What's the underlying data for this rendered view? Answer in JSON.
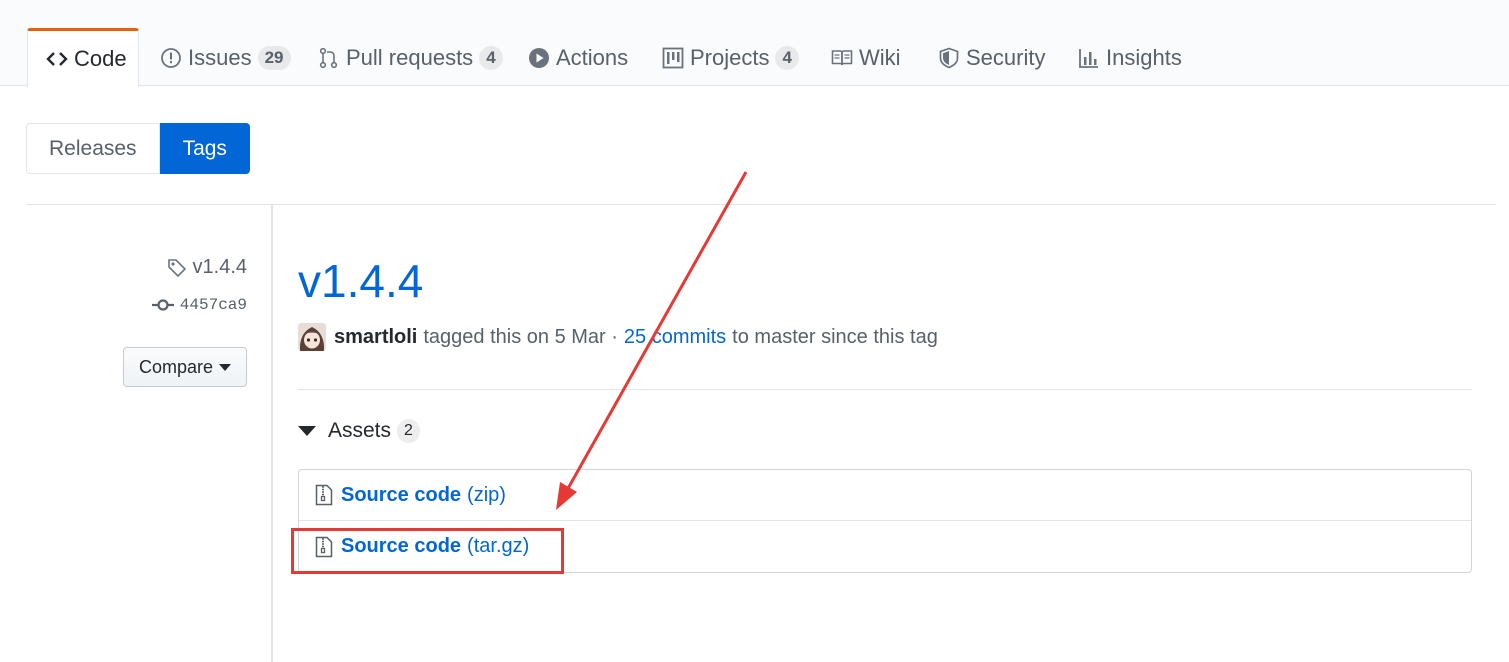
{
  "nav": {
    "tabs": [
      {
        "label": "Code",
        "icon": "code-icon",
        "selected": true
      },
      {
        "label": "Issues",
        "icon": "issue-opened-icon",
        "count": "29"
      },
      {
        "label": "Pull requests",
        "icon": "git-pull-request-icon",
        "count": "4"
      },
      {
        "label": "Actions",
        "icon": "play-icon"
      },
      {
        "label": "Projects",
        "icon": "project-icon",
        "count": "4"
      },
      {
        "label": "Wiki",
        "icon": "book-icon"
      },
      {
        "label": "Security",
        "icon": "shield-icon"
      },
      {
        "label": "Insights",
        "icon": "graph-icon"
      }
    ],
    "accent": "#e36209"
  },
  "subnav": {
    "releases_label": "Releases",
    "tags_label": "Tags"
  },
  "meta": {
    "tag": "v1.4.4",
    "commit": "4457ca9",
    "compare_label": "Compare"
  },
  "release": {
    "title": "v1.4.4",
    "author": "smartloli",
    "tagged_text": "tagged this on 5 Mar ·",
    "commits_link": "25 commits",
    "since_text": "to master since this tag"
  },
  "assets": {
    "label": "Assets",
    "count": "2",
    "items": [
      {
        "name": "Source code",
        "ext": "(zip)"
      },
      {
        "name": "Source code",
        "ext": "(tar.gz)",
        "highlighted": true
      }
    ]
  },
  "colors": {
    "link": "#0366d6",
    "annotation": "#e53935"
  }
}
